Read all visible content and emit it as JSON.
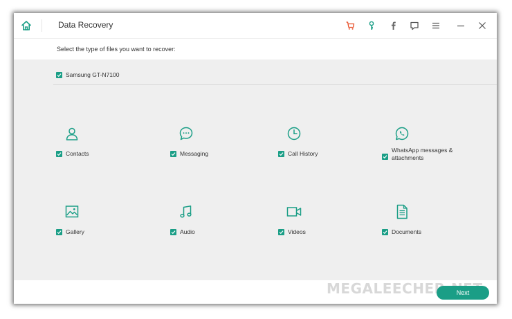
{
  "titlebar": {
    "title": "Data Recovery",
    "icons": [
      "home-icon",
      "cart-icon",
      "key-icon",
      "facebook-icon",
      "feedback-icon",
      "menu-icon",
      "minimize-icon",
      "close-icon"
    ],
    "accent_color": "#1a9e86",
    "cart_color": "#e8502a"
  },
  "subtitle": "Select the type of files you want to recover:",
  "device": {
    "label": "Samsung GT-N7100",
    "checked": true
  },
  "file_types": [
    {
      "label": "Contacts",
      "icon": "contacts-icon",
      "checked": true
    },
    {
      "label": "Messaging",
      "icon": "messaging-icon",
      "checked": true
    },
    {
      "label": "Call History",
      "icon": "call-history-icon",
      "checked": true
    },
    {
      "label": "WhatsApp messages & attachments",
      "icon": "whatsapp-icon",
      "checked": true
    },
    {
      "label": "Gallery",
      "icon": "gallery-icon",
      "checked": true
    },
    {
      "label": "Audio",
      "icon": "audio-icon",
      "checked": true
    },
    {
      "label": "Videos",
      "icon": "videos-icon",
      "checked": true
    },
    {
      "label": "Documents",
      "icon": "documents-icon",
      "checked": true
    }
  ],
  "footer": {
    "next_label": "Next",
    "watermark": "MEGALEECHER.NET"
  }
}
